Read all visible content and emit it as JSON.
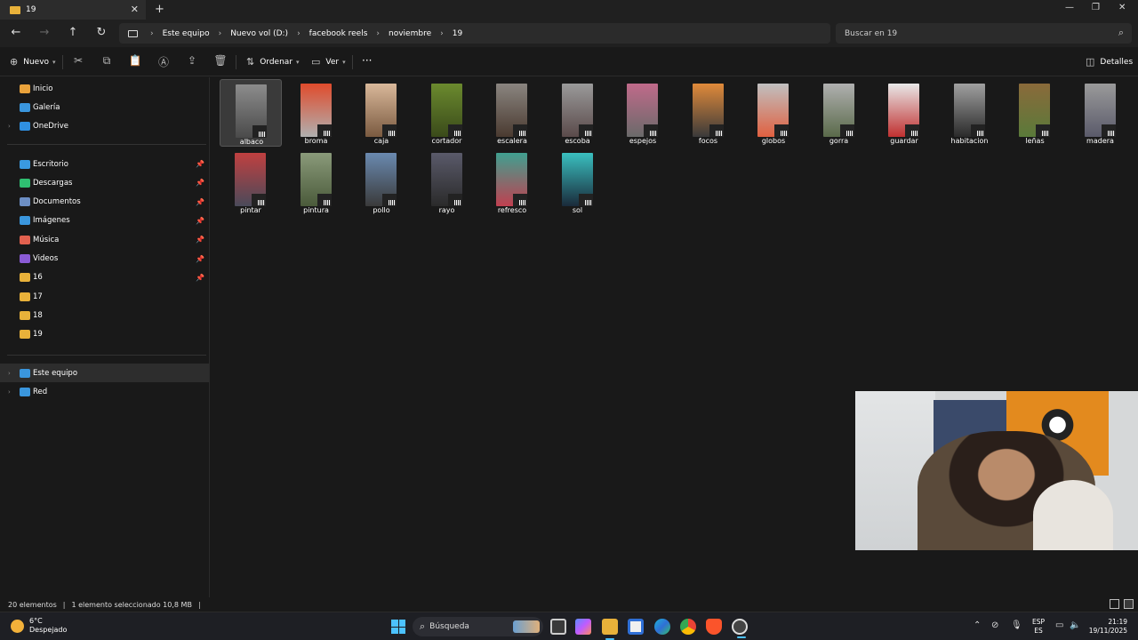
{
  "window": {
    "tab_label": "19",
    "tab_close": "✕",
    "new_tab": "+",
    "minimize": "—",
    "maximize": "❐",
    "close": "✕"
  },
  "nav": {
    "breadcrumbs": [
      "Este equipo",
      "Nuevo vol (D:)",
      "facebook reels",
      "noviembre",
      "19"
    ],
    "separator": "›",
    "search_placeholder": "Buscar en 19"
  },
  "commands": {
    "new_label": "Nuevo",
    "sort_label": "Ordenar",
    "view_label": "Ver",
    "more_label": "···",
    "details_label": "Detalles"
  },
  "sidebar": {
    "top": [
      {
        "label": "Inicio",
        "icon": "home-icon",
        "color": "#e9a23b"
      },
      {
        "label": "Galería",
        "icon": "gallery-icon",
        "color": "#3a96dd"
      },
      {
        "label": "OneDrive",
        "icon": "cloud-icon",
        "color": "#2f8fe0"
      }
    ],
    "quick": [
      {
        "label": "Escritorio",
        "icon": "desktop-icon",
        "color": "#3a9ae0",
        "pinned": true
      },
      {
        "label": "Descargas",
        "icon": "download-icon",
        "color": "#2fbf71",
        "pinned": true
      },
      {
        "label": "Documentos",
        "icon": "documents-icon",
        "color": "#6c8ec4",
        "pinned": true
      },
      {
        "label": "Imágenes",
        "icon": "pictures-icon",
        "color": "#3a96dd",
        "pinned": true
      },
      {
        "label": "Música",
        "icon": "music-icon",
        "color": "#e2614f",
        "pinned": true
      },
      {
        "label": "Videos",
        "icon": "videos-icon",
        "color": "#8a5bd6",
        "pinned": true
      },
      {
        "label": "16",
        "icon": "folder-icon",
        "color": "#e8b13a",
        "pinned": true
      },
      {
        "label": "17",
        "icon": "folder-icon",
        "color": "#e8b13a",
        "pinned": false
      },
      {
        "label": "18",
        "icon": "folder-icon",
        "color": "#e8b13a",
        "pinned": false
      },
      {
        "label": "19",
        "icon": "folder-icon",
        "color": "#e8b13a",
        "pinned": false
      }
    ],
    "bottom": [
      {
        "label": "Este equipo",
        "icon": "pc-icon",
        "color": "#3a96dd"
      },
      {
        "label": "Red",
        "icon": "network-icon",
        "color": "#3a96dd"
      }
    ],
    "pin_glyph": "📌"
  },
  "files": [
    {
      "name": "albaco",
      "c1": "#8c8c8c",
      "c2": "#4a4a4a"
    },
    {
      "name": "broma",
      "c1": "#e04b2c",
      "c2": "#b0b0b0"
    },
    {
      "name": "caja",
      "c1": "#d9b89a",
      "c2": "#7a5a40"
    },
    {
      "name": "cortador",
      "c1": "#6b8a2e",
      "c2": "#3a4a1a"
    },
    {
      "name": "escalera",
      "c1": "#8a8580",
      "c2": "#4a3a30"
    },
    {
      "name": "escoba",
      "c1": "#9a9a9a",
      "c2": "#5a4a4a"
    },
    {
      "name": "espejos",
      "c1": "#c06a8a",
      "c2": "#6a6a6a"
    },
    {
      "name": "focos",
      "c1": "#e08a3a",
      "c2": "#3a3a3a"
    },
    {
      "name": "globos",
      "c1": "#c0c0c0",
      "c2": "#e06040"
    },
    {
      "name": "gorra",
      "c1": "#b0b0b0",
      "c2": "#5a6a4a"
    },
    {
      "name": "guardar",
      "c1": "#e8e8e8",
      "c2": "#c03030"
    },
    {
      "name": "habitacion",
      "c1": "#a0a0a0",
      "c2": "#2a2a2a"
    },
    {
      "name": "leñas",
      "c1": "#8a6a3a",
      "c2": "#5a7a3a"
    },
    {
      "name": "madera",
      "c1": "#9a9a9a",
      "c2": "#5a5a6a"
    },
    {
      "name": "pintar",
      "c1": "#c04040",
      "c2": "#4a4a5a"
    },
    {
      "name": "pintura",
      "c1": "#8a9a7a",
      "c2": "#4a5a3a"
    },
    {
      "name": "pollo",
      "c1": "#6a8ab0",
      "c2": "#3a3a3a"
    },
    {
      "name": "rayo",
      "c1": "#5a5a6a",
      "c2": "#2a2a2a"
    },
    {
      "name": "refresco",
      "c1": "#40a090",
      "c2": "#c04050"
    },
    {
      "name": "sol",
      "c1": "#3ac0c0",
      "c2": "#1a2a3a"
    }
  ],
  "status": {
    "count": "20 elementos",
    "selection": "1 elemento seleccionado  10,8 MB",
    "bar": "|"
  },
  "taskbar": {
    "temp": "6°C",
    "weather": "Despejado",
    "search_label": "Búsqueda",
    "lang_top": "ESP",
    "lang_bottom": "ES",
    "time": "21:19",
    "date": "19/11/2025"
  }
}
